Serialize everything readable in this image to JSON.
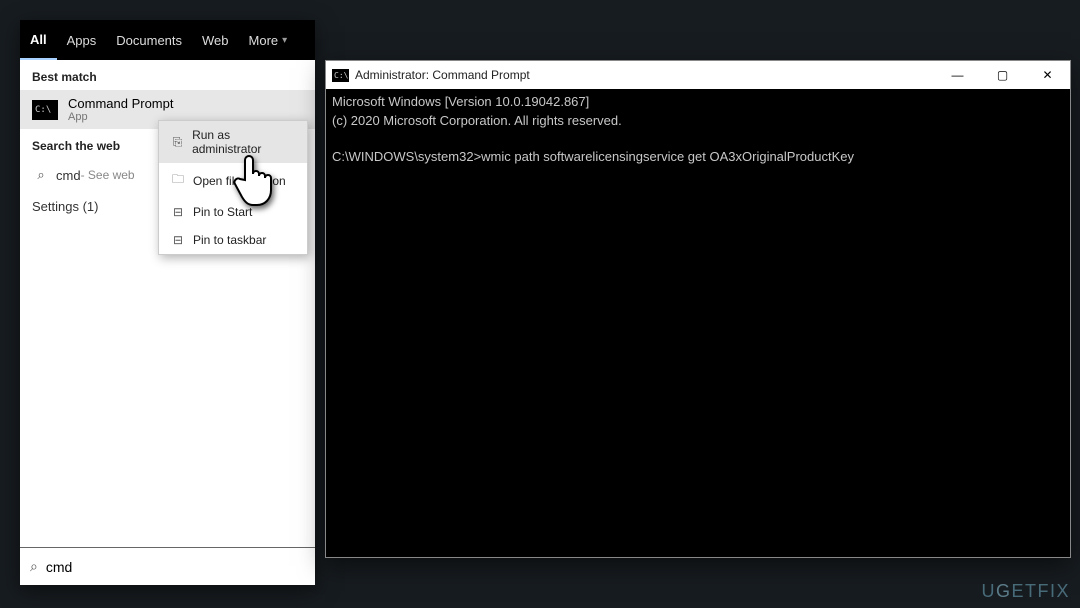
{
  "search": {
    "tabs": [
      "All",
      "Apps",
      "Documents",
      "Web",
      "More"
    ],
    "active_tab": "All",
    "best_match_label": "Best match",
    "best_match": {
      "title": "Command Prompt",
      "subtitle": "App"
    },
    "web_header": "Search the web",
    "web_query": "cmd",
    "web_hint": " - See web",
    "settings_label": "Settings (1)",
    "input_value": "cmd"
  },
  "context_menu": {
    "items": [
      {
        "icon": "⎘",
        "label": "Run as administrator"
      },
      {
        "icon": "🗀",
        "label": "Open file location"
      },
      {
        "icon": "⊟",
        "label": "Pin to Start"
      },
      {
        "icon": "⊟",
        "label": "Pin to taskbar"
      }
    ]
  },
  "cmd_window": {
    "title": "Administrator: Command Prompt",
    "lines": {
      "l1": "Microsoft Windows [Version 10.0.19042.867]",
      "l2": "(c) 2020 Microsoft Corporation. All rights reserved.",
      "l3": "",
      "prompt": "C:\\WINDOWS\\system32>",
      "command": "wmic path softwarelicensingservice get OA3xOriginalProductKey"
    }
  },
  "watermark": "UGETFIX"
}
